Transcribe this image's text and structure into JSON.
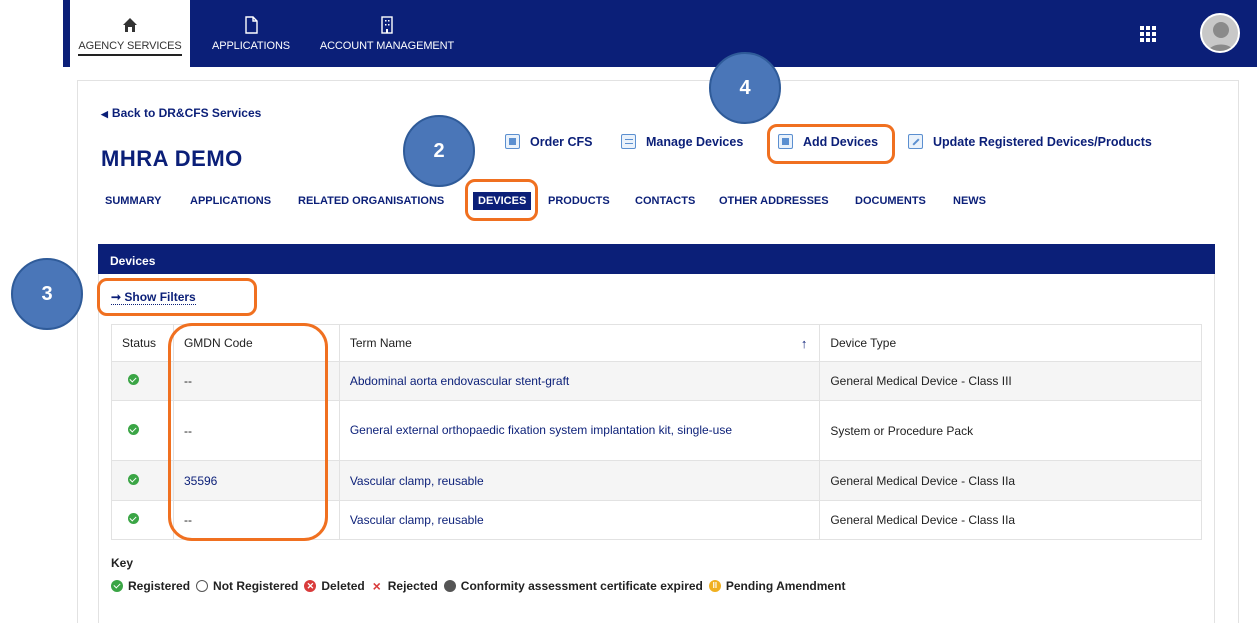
{
  "topnav": {
    "tabs": [
      {
        "label": "AGENCY SERVICES",
        "icon": "home-icon"
      },
      {
        "label": "APPLICATIONS",
        "icon": "document-icon"
      },
      {
        "label": "ACCOUNT MANAGEMENT",
        "icon": "building-icon"
      }
    ],
    "active_tab": "AGENCY SERVICES"
  },
  "page": {
    "back_link": "Back to DR&CFS Services",
    "title": "MHRA DEMO"
  },
  "actions": [
    {
      "label": "Order CFS",
      "icon": "order-icon"
    },
    {
      "label": "Manage Devices",
      "icon": "list-icon"
    },
    {
      "label": "Add Devices",
      "icon": "add-icon"
    },
    {
      "label": "Update Registered Devices/Products",
      "icon": "pencil-icon"
    }
  ],
  "subnav": [
    "SUMMARY",
    "APPLICATIONS",
    "RELATED ORGANISATIONS",
    "DEVICES",
    "PRODUCTS",
    "CONTACTS",
    "OTHER ADDRESSES",
    "DOCUMENTS",
    "NEWS"
  ],
  "subnav_active": "DEVICES",
  "devices": {
    "header": "Devices",
    "show_filters": "Show Filters",
    "columns": [
      "Status",
      "GMDN Code",
      "Term Name",
      "Device Type"
    ],
    "rows": [
      {
        "status": "registered",
        "gmdn": "--",
        "term": "Abdominal aorta endovascular stent-graft",
        "type": "General Medical Device - Class III"
      },
      {
        "status": "registered",
        "gmdn": "--",
        "term": "General external orthopaedic fixation system implantation kit, single-use",
        "type": "System or Procedure Pack"
      },
      {
        "status": "registered",
        "gmdn": "35596",
        "term": "Vascular clamp, reusable",
        "type": "General Medical Device - Class IIa"
      },
      {
        "status": "registered",
        "gmdn": "--",
        "term": "Vascular clamp, reusable",
        "type": "General Medical Device - Class IIa"
      }
    ]
  },
  "key": {
    "title": "Key",
    "items": [
      "Registered",
      "Not Registered",
      "Deleted",
      "Rejected",
      "Conformity assessment certificate expired",
      "Pending Amendment"
    ]
  },
  "callouts": [
    "2",
    "3",
    "4"
  ],
  "colors": {
    "brand_navy": "#0b1f78",
    "highlight_orange": "#f07020",
    "callout_blue": "#4a76b8",
    "status_green": "#3aa545"
  }
}
